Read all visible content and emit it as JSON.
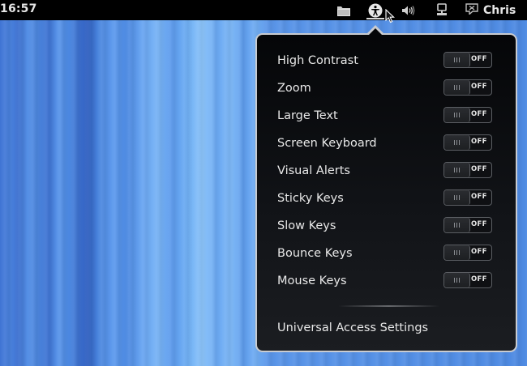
{
  "topbar": {
    "clock": "16:57",
    "user_name": "Chris",
    "icons": [
      "folder-icon",
      "accessibility-icon",
      "volume-icon",
      "network-icon",
      "user-status-icon"
    ]
  },
  "menu": {
    "items": [
      {
        "label": "High Contrast",
        "state": "OFF"
      },
      {
        "label": "Zoom",
        "state": "OFF"
      },
      {
        "label": "Large Text",
        "state": "OFF"
      },
      {
        "label": "Screen Keyboard",
        "state": "OFF"
      },
      {
        "label": "Visual Alerts",
        "state": "OFF"
      },
      {
        "label": "Sticky Keys",
        "state": "OFF"
      },
      {
        "label": "Slow Keys",
        "state": "OFF"
      },
      {
        "label": "Bounce Keys",
        "state": "OFF"
      },
      {
        "label": "Mouse Keys",
        "state": "OFF"
      }
    ],
    "settings_label": "Universal Access Settings"
  },
  "colors": {
    "menu_background": "#0b0c0f",
    "menu_border": "#c9cbcf",
    "topbar_background": "#000000",
    "text": "#e8e8e8"
  }
}
